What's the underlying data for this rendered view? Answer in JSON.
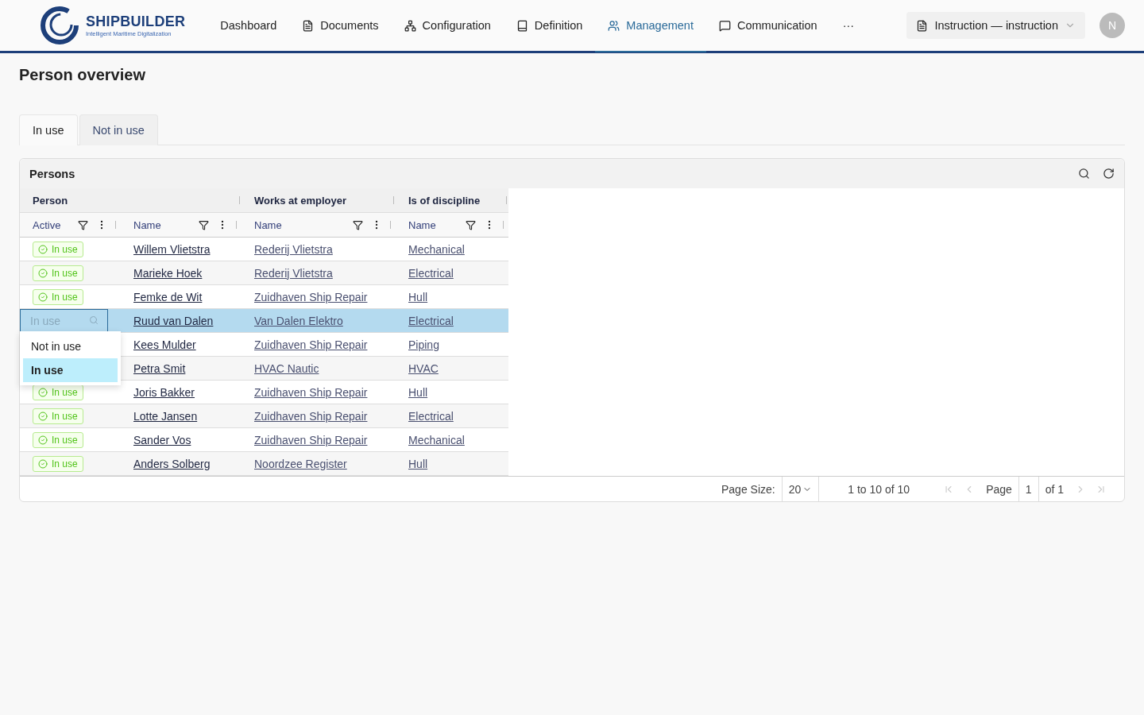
{
  "brand": {
    "name": "SHIPBUILDER",
    "tagline": "Intelligent Maritime Digitalization"
  },
  "nav": [
    {
      "label": "Dashboard",
      "kind": "plain",
      "selected": false
    },
    {
      "label": "Documents",
      "kind": "document",
      "selected": false
    },
    {
      "label": "Configuration",
      "kind": "hierarchy",
      "selected": false
    },
    {
      "label": "Definition",
      "kind": "book",
      "selected": false
    },
    {
      "label": "Management",
      "kind": "people",
      "selected": true
    },
    {
      "label": "Communication",
      "kind": "chat",
      "selected": false
    },
    {
      "label": "···",
      "kind": "plain",
      "selected": false
    }
  ],
  "context_selector": {
    "label": "Instruction — instruction"
  },
  "avatar": {
    "initial": "N"
  },
  "page_title": "Person overview",
  "tabs": [
    {
      "label": "In use",
      "selected": true
    },
    {
      "label": "Not in use",
      "selected": false
    }
  ],
  "panel": {
    "title": "Persons"
  },
  "table": {
    "groups": [
      "Person",
      "Works at employer",
      "Is of discipline"
    ],
    "columns": [
      "Active",
      "Name",
      "Name",
      "Name"
    ],
    "editor": {
      "placeholder": "In use"
    },
    "dropdown": [
      {
        "label": "Not in use",
        "selected": false
      },
      {
        "label": "In use",
        "selected": true
      }
    ],
    "rows": [
      {
        "active": "In use",
        "name": "Willem Vlietstra",
        "employer": "Rederij Vlietstra",
        "discipline": "Mechanical",
        "selected": false
      },
      {
        "active": "In use",
        "name": "Marieke Hoek",
        "employer": "Rederij Vlietstra",
        "discipline": "Electrical",
        "selected": false
      },
      {
        "active": "In use",
        "name": "Femke de Wit",
        "employer": "Zuidhaven Ship Repair",
        "discipline": "Hull",
        "selected": false
      },
      {
        "name": "Ruud van Dalen",
        "employer": "Van Dalen Elektro",
        "discipline": "Electrical",
        "selected": true
      },
      {
        "name": "Kees Mulder",
        "employer": "Zuidhaven Ship Repair",
        "discipline": "Piping",
        "selected": false
      },
      {
        "name": "Petra Smit",
        "employer": "HVAC Nautic",
        "discipline": "HVAC",
        "selected": false
      },
      {
        "active": "In use",
        "name": "Joris Bakker",
        "employer": "Zuidhaven Ship Repair",
        "discipline": "Hull",
        "selected": false
      },
      {
        "active": "In use",
        "name": "Lotte Jansen",
        "employer": "Zuidhaven Ship Repair",
        "discipline": "Electrical",
        "selected": false
      },
      {
        "active": "In use",
        "name": "Sander Vos",
        "employer": "Zuidhaven Ship Repair",
        "discipline": "Mechanical",
        "selected": false
      },
      {
        "active": "In use",
        "name": "Anders Solberg",
        "employer": "Noordzee Register",
        "discipline": "Hull",
        "selected": false
      }
    ]
  },
  "pagination": {
    "page_size_label": "Page Size:",
    "page_size": "20",
    "range": "1 to 10 of 10",
    "page_label": "Page",
    "page": "1",
    "of": "of 1"
  }
}
